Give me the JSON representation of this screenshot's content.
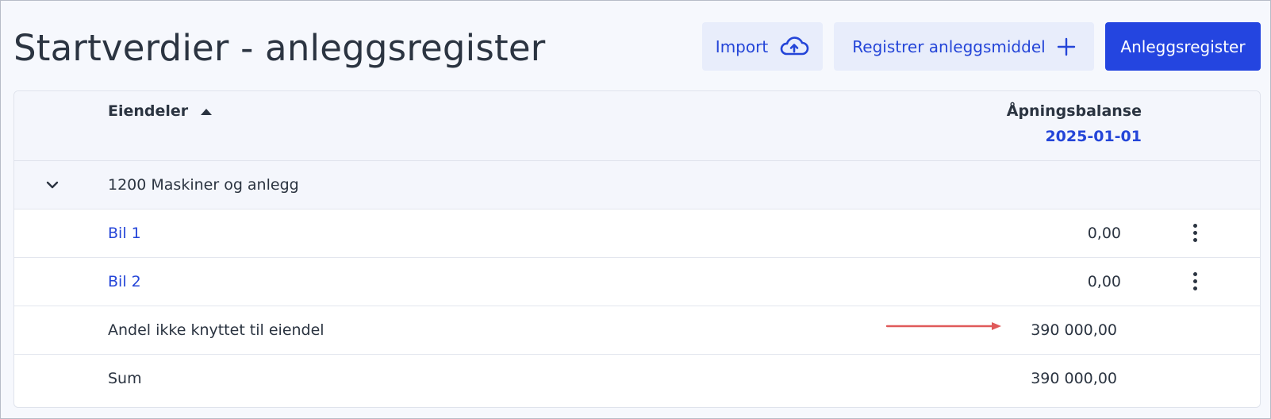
{
  "header": {
    "title": "Startverdier - anleggsregister",
    "buttons": {
      "import_label": "Import",
      "register_label": "Registrer anleggsmiddel",
      "register_main_label": "Anleggsregister"
    }
  },
  "table": {
    "col_assets": "Eiendeler",
    "col_balance": "Åpningsbalanse",
    "col_balance_date": "2025-01-01",
    "group": {
      "label": "1200 Maskiner og anlegg"
    },
    "rows": [
      {
        "label": "Bil 1",
        "amount": "0,00"
      },
      {
        "label": "Bil 2",
        "amount": "0,00"
      },
      {
        "label": "Andel ikke knyttet til eiendel",
        "amount": "390 000,00"
      },
      {
        "label": "Sum",
        "amount": "390 000,00"
      }
    ]
  },
  "icons": {
    "import": "cloud-upload-icon",
    "register": "plus-icon",
    "sort": "sort-ascending-icon",
    "group": "chevron-down-icon",
    "row_menu": "kebab-menu-icon",
    "annotation": "red-arrow-annotation"
  },
  "colors": {
    "accent": "#2445e0",
    "link": "#2445d8",
    "annotation": "#e05a5a"
  }
}
